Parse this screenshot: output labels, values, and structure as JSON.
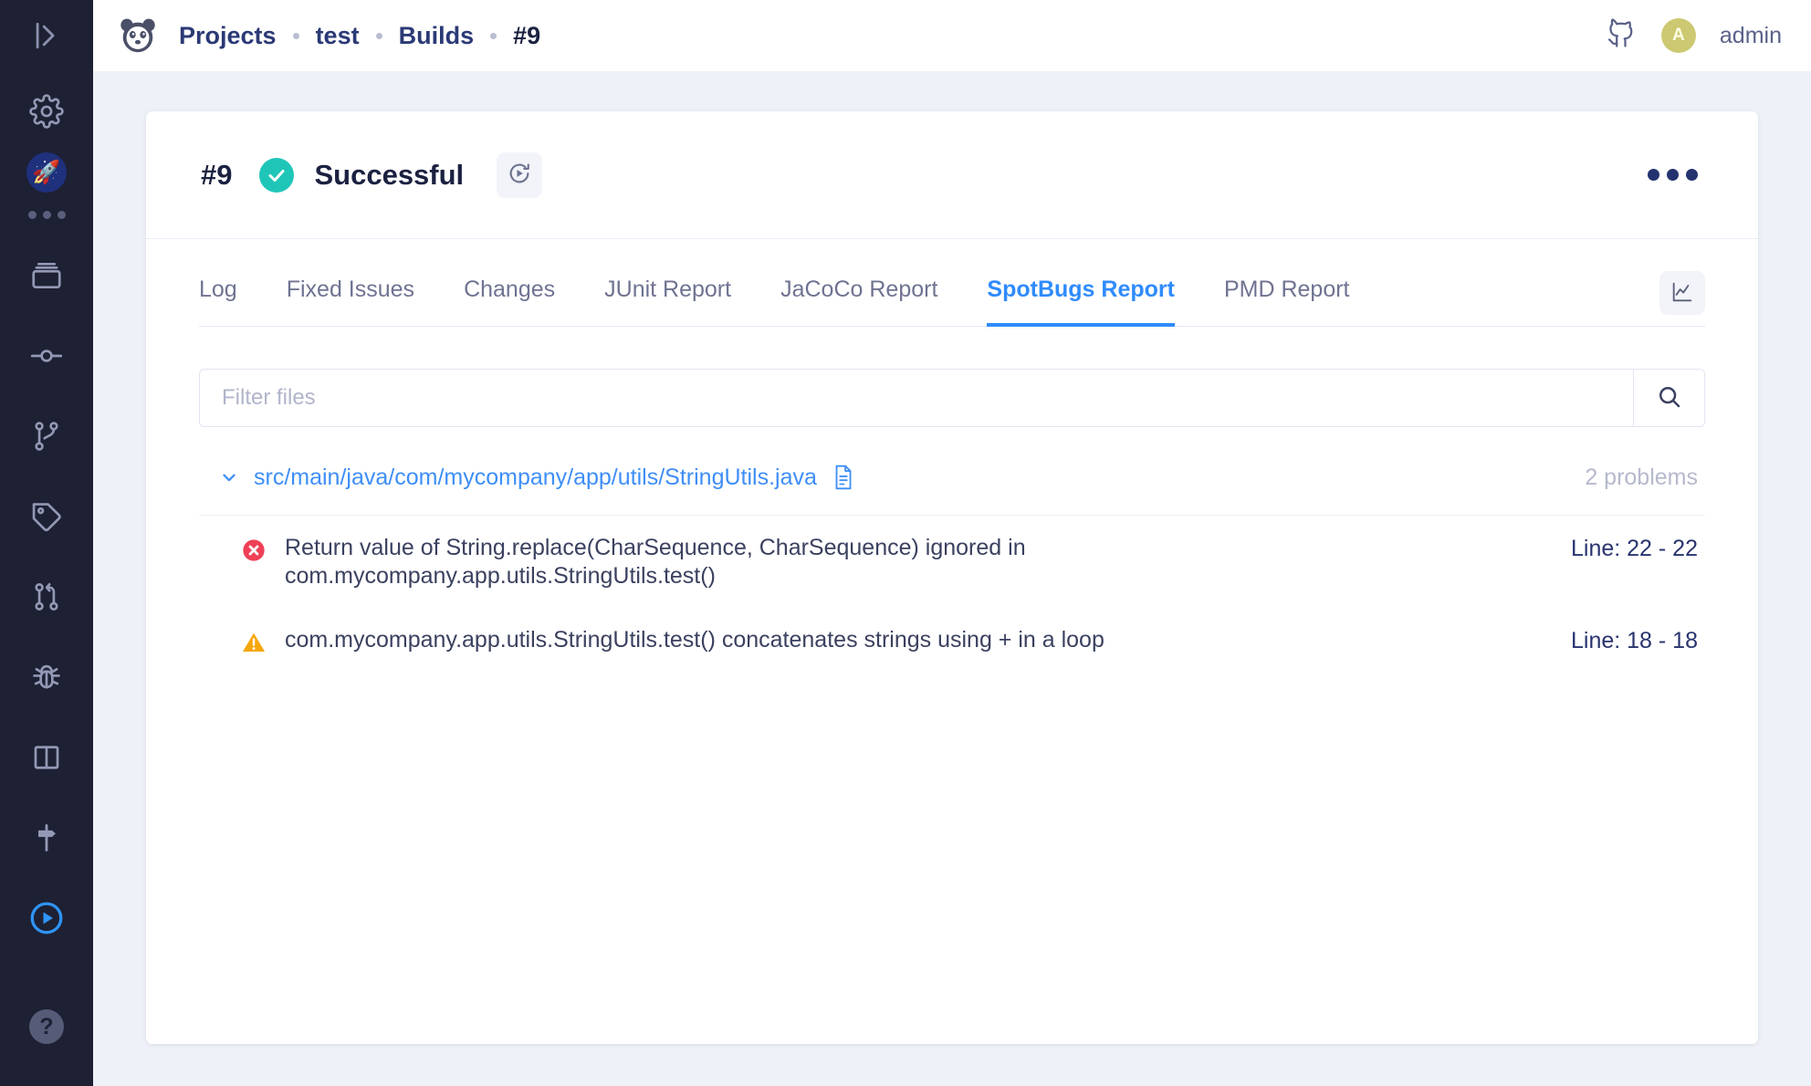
{
  "sidebar": {
    "collapse_icon": "collapse-panel-icon",
    "items": [
      {
        "name": "settings",
        "icon": "gear-icon"
      },
      {
        "name": "project-avatar",
        "icon": "rocket-icon",
        "glyph": "🚀"
      },
      {
        "name": "more",
        "icon": "ellipsis-icon"
      },
      {
        "name": "builds",
        "icon": "archive-box-icon"
      },
      {
        "name": "commits",
        "icon": "commit-node-icon"
      },
      {
        "name": "branches",
        "icon": "branch-icon"
      },
      {
        "name": "tags",
        "icon": "tag-icon"
      },
      {
        "name": "pull-requests",
        "icon": "pull-request-icon"
      },
      {
        "name": "issues",
        "icon": "bug-icon"
      },
      {
        "name": "boards",
        "icon": "board-columns-icon"
      },
      {
        "name": "milestones",
        "icon": "signpost-icon"
      },
      {
        "name": "run-job",
        "icon": "play-circle-icon",
        "active": true
      },
      {
        "name": "help",
        "icon": "help-circle-icon",
        "glyph": "?"
      }
    ]
  },
  "topbar": {
    "logo_icon": "panda-logo-icon",
    "breadcrumbs": [
      {
        "label": "Projects",
        "current": false
      },
      {
        "label": "test",
        "current": false
      },
      {
        "label": "Builds",
        "current": false
      },
      {
        "label": "#9",
        "current": true
      }
    ],
    "github_icon": "github-icon",
    "avatar_initial": "A",
    "avatar_color": "#ccc972",
    "username": "admin"
  },
  "build": {
    "number": "#9",
    "status_label": "Successful",
    "status_color": "#1fc6b8",
    "status_icon": "check-circle-icon",
    "rerun_icon": "rerun-icon",
    "menu_icon": "ellipsis-horizontal-icon"
  },
  "tabs": {
    "items": [
      {
        "label": "Log",
        "active": false
      },
      {
        "label": "Fixed Issues",
        "active": false
      },
      {
        "label": "Changes",
        "active": false
      },
      {
        "label": "JUnit Report",
        "active": false
      },
      {
        "label": "JaCoCo Report",
        "active": false
      },
      {
        "label": "SpotBugs Report",
        "active": true
      },
      {
        "label": "PMD Report",
        "active": false
      }
    ],
    "active_color": "#2f8bfd",
    "chart_button_icon": "line-chart-icon"
  },
  "filter": {
    "placeholder": "Filter files",
    "value": "",
    "search_icon": "search-icon"
  },
  "report": {
    "files": [
      {
        "path": "src/main/java/com/mycompany/app/utils/StringUtils.java",
        "expanded": true,
        "chevron_icon": "chevron-down-icon",
        "file_icon": "file-document-icon",
        "problem_count": "2 problems",
        "issues": [
          {
            "severity": "error",
            "severity_icon": "error-circle-icon",
            "severity_color": "#ef4056",
            "message": "Return value of String.replace(CharSequence, CharSequence) ignored in com.mycompany.app.utils.StringUtils.test()",
            "line": "Line: 22 - 22"
          },
          {
            "severity": "warning",
            "severity_icon": "warning-triangle-icon",
            "severity_color": "#f6a609",
            "message": "com.mycompany.app.utils.StringUtils.test() concatenates strings using + in a loop",
            "line": "Line: 18 - 18"
          }
        ]
      }
    ]
  }
}
